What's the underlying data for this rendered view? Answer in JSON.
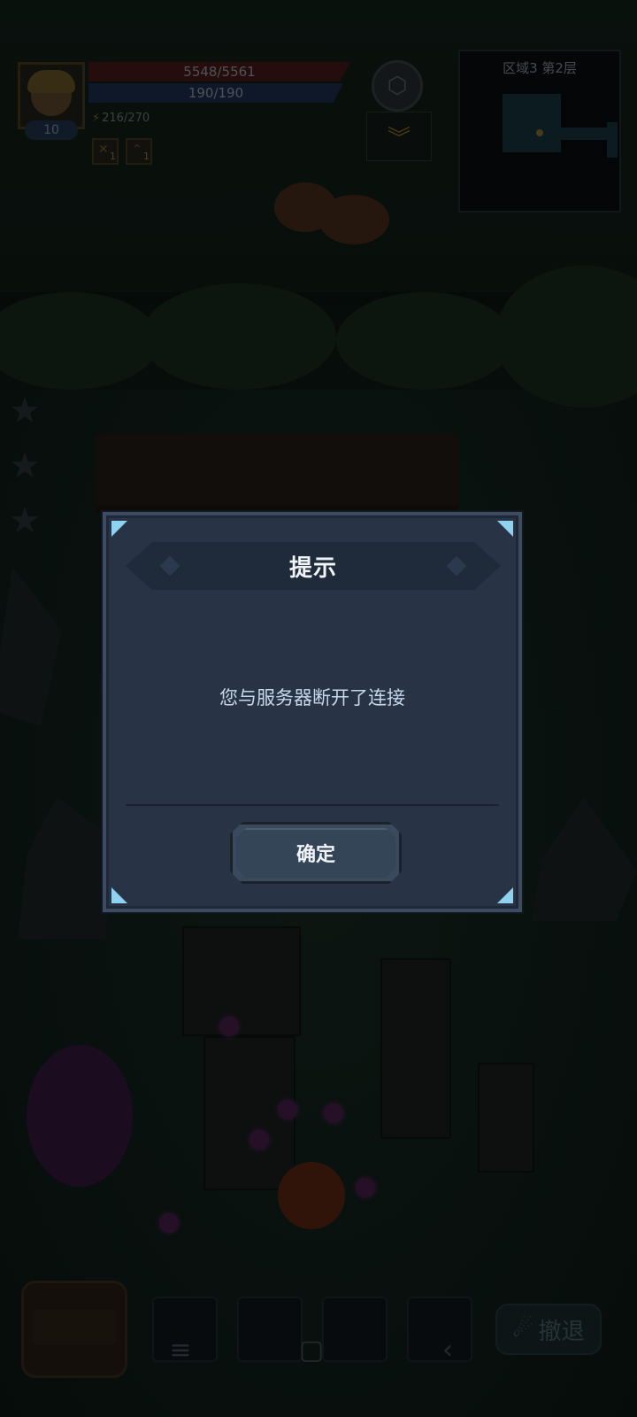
{
  "hud": {
    "level": "10",
    "hp": "5548/5561",
    "mp": "190/190",
    "energy": "216/270",
    "buffs": [
      {
        "icon": "sword-buff-icon",
        "count": "1"
      },
      {
        "icon": "arrow-up-buff-icon",
        "count": "1"
      }
    ]
  },
  "minimap": {
    "title": "区域3 第2层"
  },
  "bottom_bar": {
    "retreat_label": "撤退"
  },
  "dialog": {
    "title": "提示",
    "message": "您与服务器断开了连接",
    "confirm_label": "确定"
  },
  "colors": {
    "dialog_bg": "#283346",
    "dialog_border": "#3d4c60",
    "corner_accent": "#8fd2f0",
    "button_bg": "#354558"
  }
}
